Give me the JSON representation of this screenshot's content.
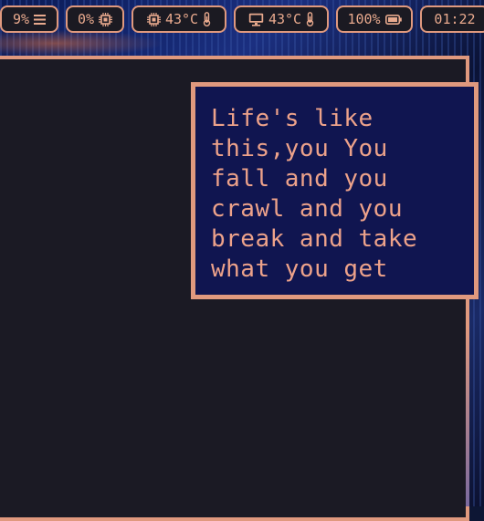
{
  "status_bar": {
    "memory": {
      "value": "9%",
      "icon": "menu-icon"
    },
    "cpu": {
      "value": "0%",
      "icon": "cpu-chip-icon"
    },
    "cpu_temp": {
      "value": "43°C",
      "icon": "thermometer-icon",
      "leading_icon": "cpu-chip-icon"
    },
    "gpu_temp": {
      "value": "43°C",
      "icon": "thermometer-icon",
      "leading_icon": "monitor-icon"
    },
    "battery": {
      "value": "100%",
      "icon": "battery-icon"
    },
    "clock": {
      "value": "01:22"
    }
  },
  "notification": {
    "lines": [
      "Life's like",
      "this,you You",
      "fall and you",
      "crawl and you",
      "break and take",
      "what you get"
    ]
  },
  "colors": {
    "accent": "#e0997e",
    "text": "#eda28a",
    "terminal_bg": "#1b1a24",
    "popup_bg": "#101550"
  }
}
